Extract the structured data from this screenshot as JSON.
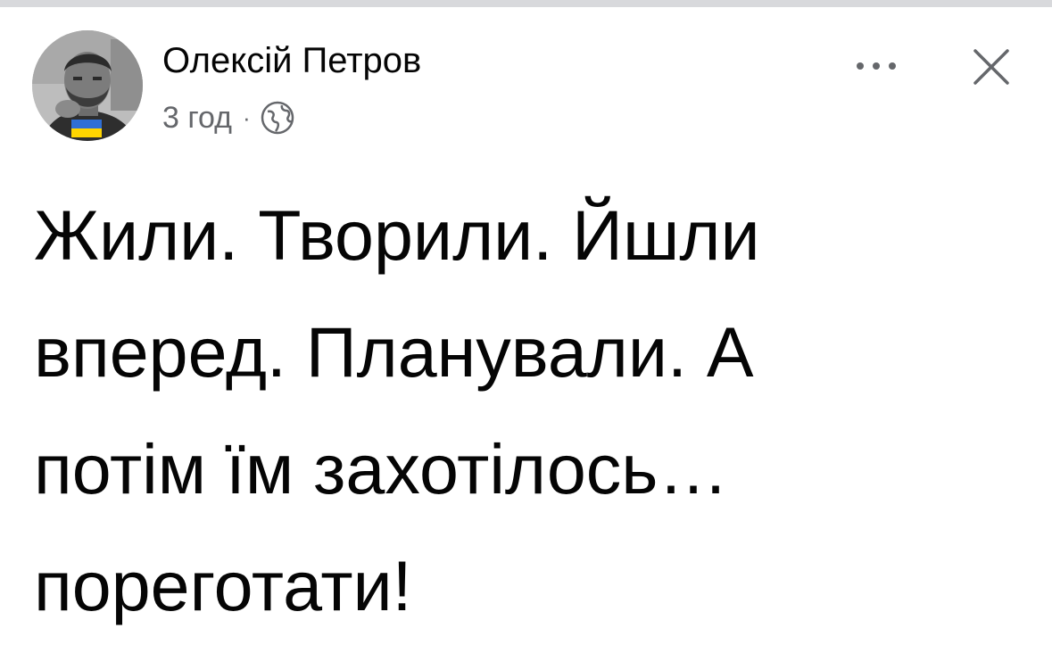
{
  "post": {
    "author": {
      "name": "Олексій Петров",
      "avatar_icon": "profile-photo",
      "badge_icon": "ukraine-flag-icon"
    },
    "time": "3 год",
    "separator": "·",
    "audience_icon": "globe-icon",
    "actions": {
      "more_icon": "more-options-icon",
      "close_icon": "close-icon"
    },
    "text_lines": [
      "Жили. Творили. Йшли",
      "вперед. Планували. А",
      "потім їм захотілось…",
      "пореготати!"
    ]
  },
  "colors": {
    "background": "#ffffff",
    "text_primary": "#050505",
    "text_secondary": "#65676b",
    "top_strip": "#d8d9dc",
    "flag_blue": "#2f6fd6",
    "flag_yellow": "#ffd500"
  }
}
